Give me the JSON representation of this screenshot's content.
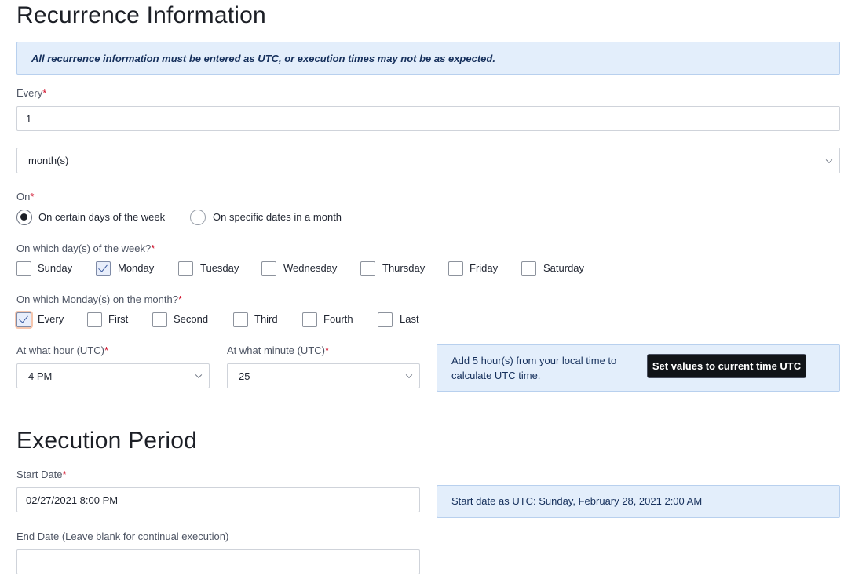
{
  "recurrence": {
    "title": "Recurrence Information",
    "banner": "All recurrence information must be entered as UTC, or execution times may not be as expected.",
    "every_label": "Every",
    "every_value": "1",
    "unit_value": "month(s)",
    "on_label": "On",
    "on_options": [
      "On certain days of the week",
      "On specific dates in a month"
    ],
    "on_selected": 0,
    "weekday_label": "On which day(s) of the week?",
    "weekdays": [
      {
        "label": "Sunday",
        "checked": false
      },
      {
        "label": "Monday",
        "checked": true
      },
      {
        "label": "Tuesday",
        "checked": false
      },
      {
        "label": "Wednesday",
        "checked": false
      },
      {
        "label": "Thursday",
        "checked": false
      },
      {
        "label": "Friday",
        "checked": false
      },
      {
        "label": "Saturday",
        "checked": false
      }
    ],
    "which_label": "On which Monday(s) on the month?",
    "which_options": [
      {
        "label": "Every",
        "checked": true
      },
      {
        "label": "First",
        "checked": false
      },
      {
        "label": "Second",
        "checked": false
      },
      {
        "label": "Third",
        "checked": false
      },
      {
        "label": "Fourth",
        "checked": false
      },
      {
        "label": "Last",
        "checked": false
      }
    ],
    "hour_label": "At what hour (UTC)",
    "hour_value": "4 PM",
    "minute_label": "At what minute (UTC)",
    "minute_value": "25",
    "utc_info": "Add 5 hour(s) from your local time to calculate UTC time.",
    "utc_button": "Set values to current time UTC"
  },
  "execution": {
    "title": "Execution Period",
    "start_label": "Start Date",
    "start_value": "02/27/2021 8:00 PM",
    "start_utc": "Start date as UTC: Sunday, February 28, 2021 2:00 AM",
    "end_label": "End Date (Leave blank for continual execution)",
    "end_value": ""
  },
  "required_marker": "*"
}
